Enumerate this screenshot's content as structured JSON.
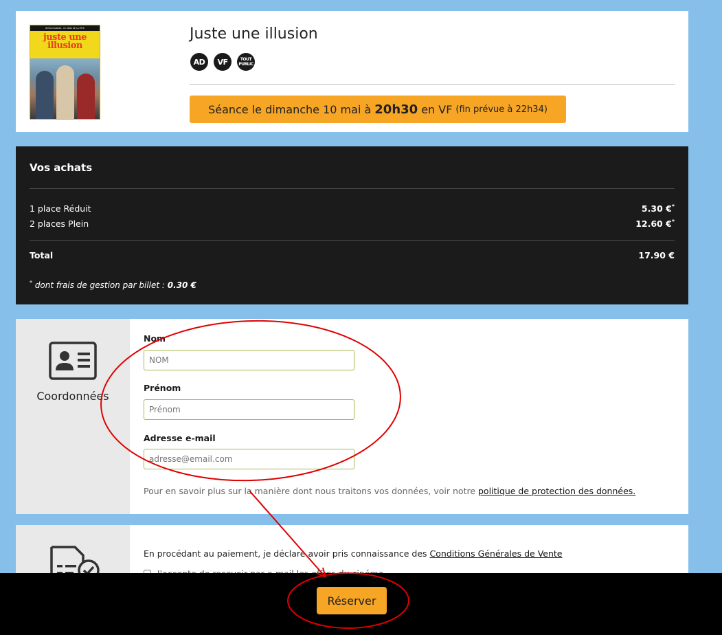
{
  "movie": {
    "title": "Juste une illusion",
    "poster": {
      "top_text": "INTOUCHABLES · LE SENS DE LA FÊTE",
      "title": "juste une illusion"
    },
    "badges": [
      {
        "text": "AD",
        "icon": "audio-description-icon"
      },
      {
        "text": "VF",
        "icon": "vf-icon"
      },
      {
        "text": "TOUT PUBLIC",
        "icon": "tout-public-icon"
      }
    ],
    "seance": {
      "prefix": "Séance le dimanche 10 mai à",
      "time": "20h30",
      "version": "en VF",
      "end": "(fin prévue à 22h34)"
    }
  },
  "purchases": {
    "title": "Vos achats",
    "lines": [
      {
        "label": "1 place Réduit",
        "price": "5.30 €",
        "mark": "*"
      },
      {
        "label": "2 places Plein",
        "price": "12.60 €",
        "mark": "*"
      }
    ],
    "total_label": "Total",
    "total_value": "17.90 €",
    "note_mark": "*",
    "note_text": " dont frais de gestion par billet : ",
    "note_value": "0.30 €"
  },
  "contact": {
    "section_label": "Coordonnées",
    "nom_label": "Nom",
    "nom_placeholder": "NOM",
    "prenom_label": "Prénom",
    "prenom_placeholder": "Prénom",
    "email_label": "Adresse e-mail",
    "email_placeholder": "adresse@email.com",
    "privacy_text": "Pour en savoir plus sur la manière dont nous traitons vos données, voir notre ",
    "privacy_link": "politique de protection des données."
  },
  "conditions": {
    "text": "En procédant au paiement, je déclare avoir pris connaissance des ",
    "link": "Conditions Générales de Vente",
    "checkbox_text": "J'accepte de recevoir par e-mail les offres du cinéma"
  },
  "footer": {
    "reserve_label": "Réserver"
  },
  "colors": {
    "page_bg": "#86c0ea",
    "accent": "#f7a525",
    "dark_panel": "#1b1b1b",
    "annotation": "#e00000"
  }
}
